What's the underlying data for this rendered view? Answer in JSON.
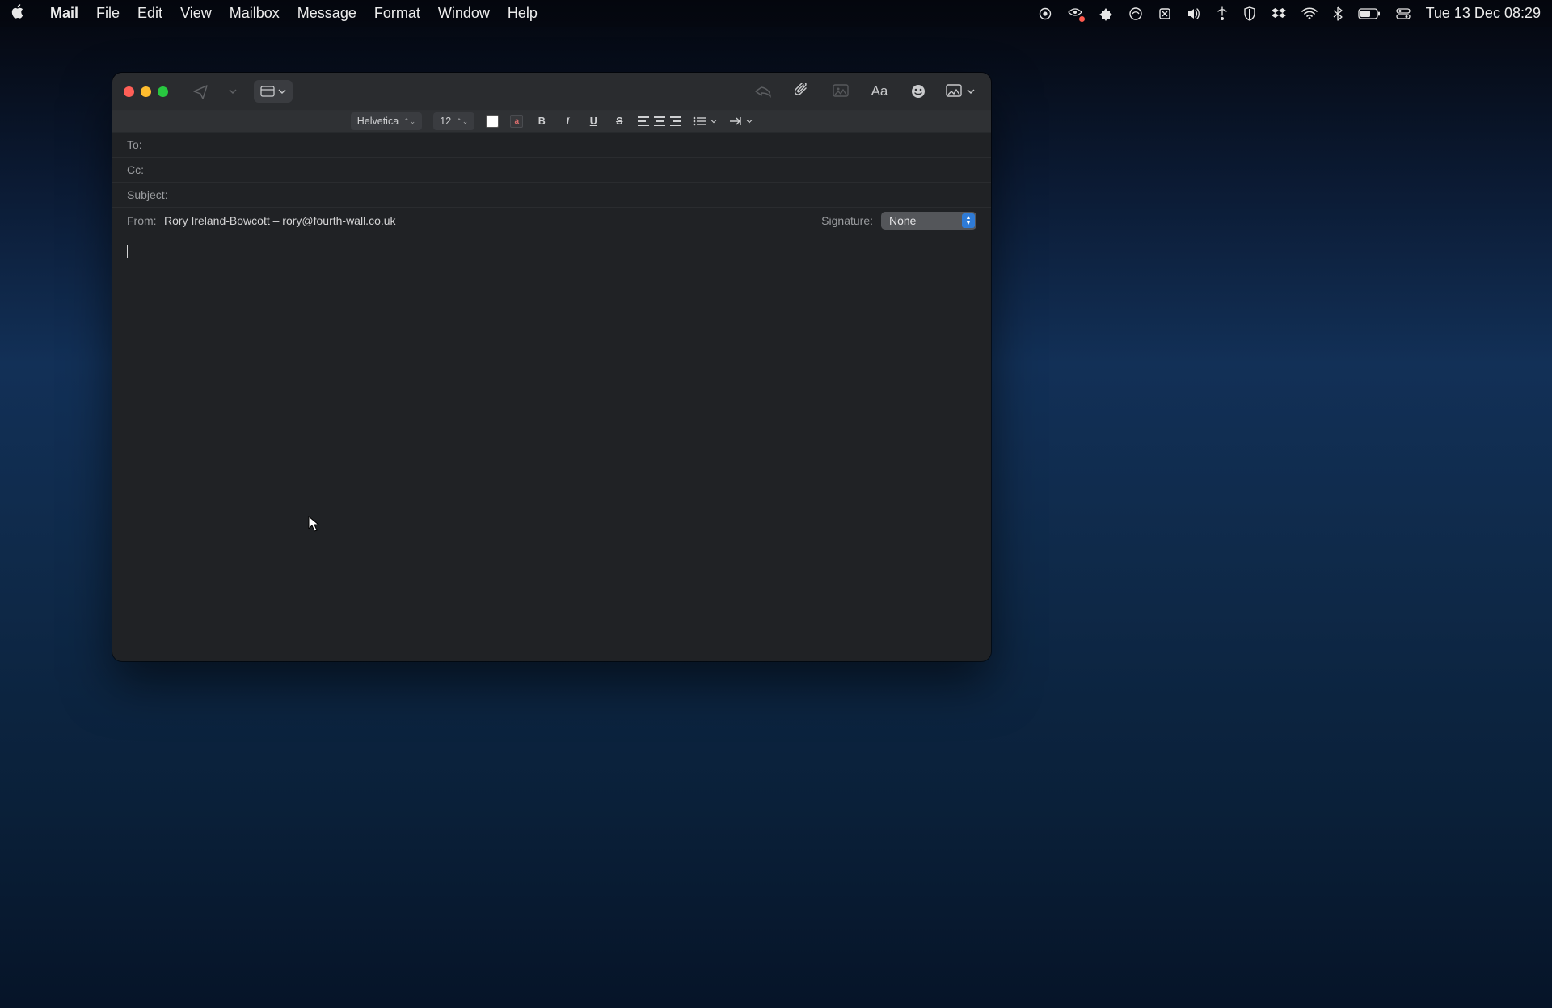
{
  "menubar": {
    "app": "Mail",
    "items": [
      "File",
      "Edit",
      "View",
      "Mailbox",
      "Message",
      "Format",
      "Window",
      "Help"
    ],
    "clock": "Tue 13 Dec  08:29"
  },
  "toolbar": {
    "send_tooltip": "Send"
  },
  "formatbar": {
    "font": "Helvetica",
    "size": "12",
    "swatch_char": "a",
    "bold": "B",
    "italic": "I",
    "underline": "U",
    "strike": "S"
  },
  "fields": {
    "to_label": "To:",
    "to_value": "",
    "cc_label": "Cc:",
    "cc_value": "",
    "subject_label": "Subject:",
    "subject_value": "",
    "from_label": "From:",
    "from_value": "Rory Ireland-Bowcott – rory@fourth-wall.co.uk",
    "signature_label": "Signature:",
    "signature_value": "None"
  },
  "body": {
    "content": ""
  }
}
